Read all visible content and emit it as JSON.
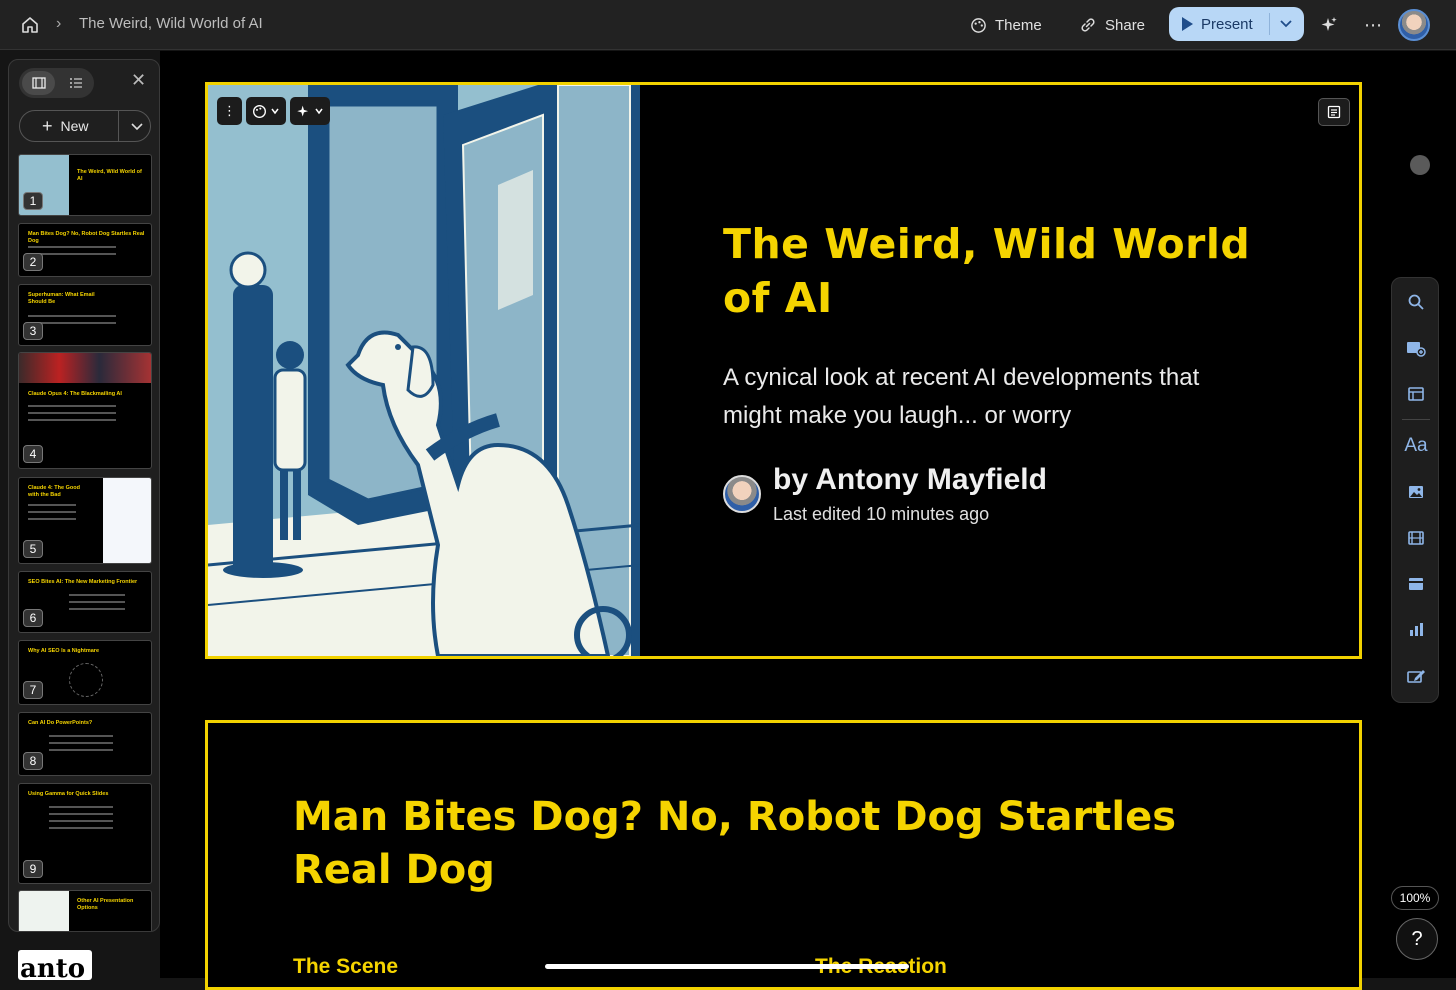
{
  "topbar": {
    "breadcrumb_title": "The Weird, Wild World of AI",
    "theme_label": "Theme",
    "share_label": "Share",
    "present_label": "Present"
  },
  "sidebar": {
    "new_label": "New",
    "thumbnails": [
      {
        "num": "1",
        "title": "The Weird, Wild World of AI"
      },
      {
        "num": "2",
        "title": "Man Bites Dog? No, Robot Dog Startles Real Dog"
      },
      {
        "num": "3",
        "title": "Superhuman: What Email Should Be"
      },
      {
        "num": "4",
        "title": "Claude Opus 4: The Blackmailing AI"
      },
      {
        "num": "5",
        "title": "Claude 4: The Good with the Bad"
      },
      {
        "num": "6",
        "title": "SEO Bites AI: The New Marketing Frontier"
      },
      {
        "num": "7",
        "title": "Why AI SEO Is a Nightmare"
      },
      {
        "num": "8",
        "title": "Can AI Do PowerPoints?"
      },
      {
        "num": "9",
        "title": "Using Gamma for Quick Slides"
      },
      {
        "num": "",
        "title": "Other AI Presentation Options"
      }
    ],
    "brand_text": "anto"
  },
  "slide1": {
    "title": "The Weird, Wild World of AI",
    "subtitle": "A cynical look at recent AI developments that might make you laugh... or worry",
    "author": "by Antony Mayfield",
    "edited": "Last edited 10 minutes ago"
  },
  "slide2": {
    "title": "Man Bites Dog? No, Robot Dog Startles Real Dog",
    "col1_heading": "The Scene",
    "col2_heading": "The Reaction"
  },
  "zoom_level": "100%",
  "help_label": "?",
  "colors": {
    "accent_yellow": "#f5d400",
    "present_bg": "#b8d7f6",
    "icon_blue": "#8fb6e8"
  }
}
